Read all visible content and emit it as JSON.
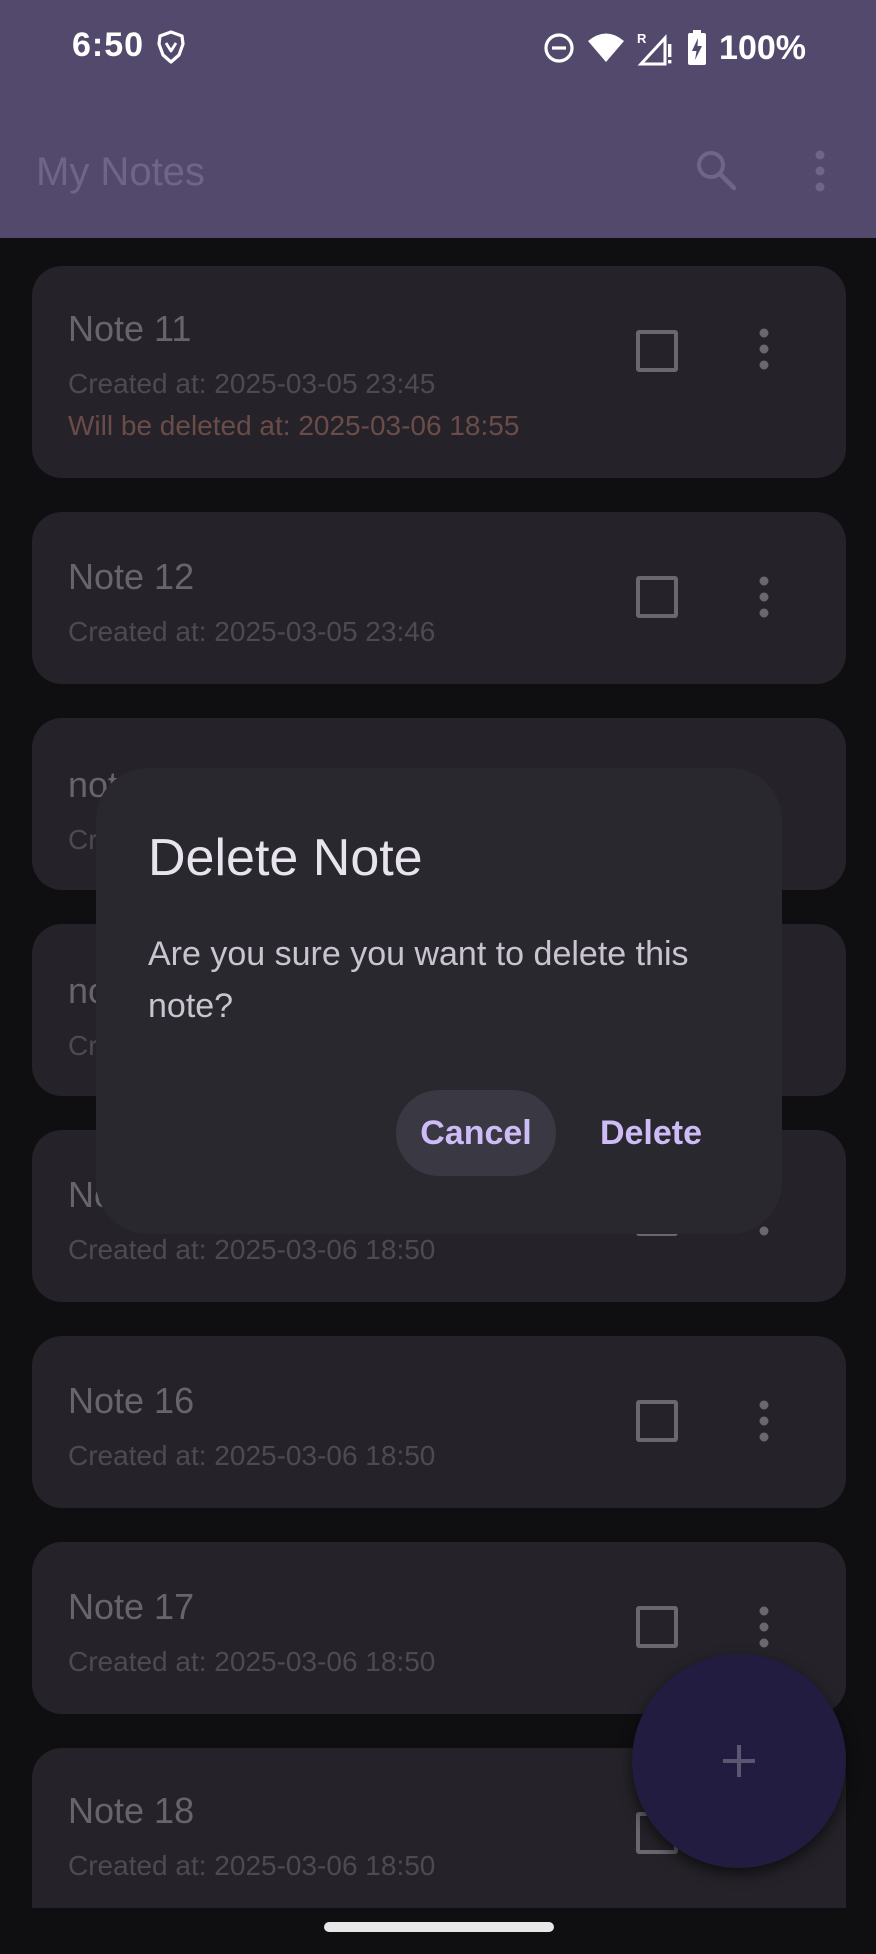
{
  "status_bar": {
    "time": "6:50",
    "battery_text": "100%",
    "icons": [
      "brave-icon",
      "do-not-disturb-icon",
      "wifi-icon",
      "signal-roaming-icon",
      "battery-charging-icon"
    ]
  },
  "app_bar": {
    "title": "My Notes",
    "icons": [
      "search-icon",
      "more-vert-icon"
    ]
  },
  "notes": [
    {
      "title": "Note 11",
      "created": "Created at: 2025-03-05 23:45",
      "deletion": "Will be deleted at: 2025-03-06 18:55"
    },
    {
      "title": "Note 12",
      "created": "Created at: 2025-03-05 23:46"
    },
    {
      "title": "not",
      "created": "Cre"
    },
    {
      "title": "no",
      "created": "Cr"
    },
    {
      "title": "No",
      "created": "Created at: 2025-03-06 18:50"
    },
    {
      "title": "Note 16",
      "created": "Created at: 2025-03-06 18:50"
    },
    {
      "title": "Note 17",
      "created": "Created at: 2025-03-06 18:50"
    },
    {
      "title": "Note 18",
      "created": "Created at: 2025-03-06 18:50"
    }
  ],
  "dialog": {
    "title": "Delete Note",
    "message": "Are you sure you want to delete this note?",
    "cancel_label": "Cancel",
    "confirm_label": "Delete"
  },
  "fab": {
    "icon": "add-icon"
  },
  "colors": {
    "app_bar": "#53496c",
    "background": "#0f0f11",
    "card": "#252329",
    "dialog": "#2a282f",
    "accent": "#cdbcf6",
    "fab": "#221c40",
    "warning_text": "#6a4c48"
  }
}
